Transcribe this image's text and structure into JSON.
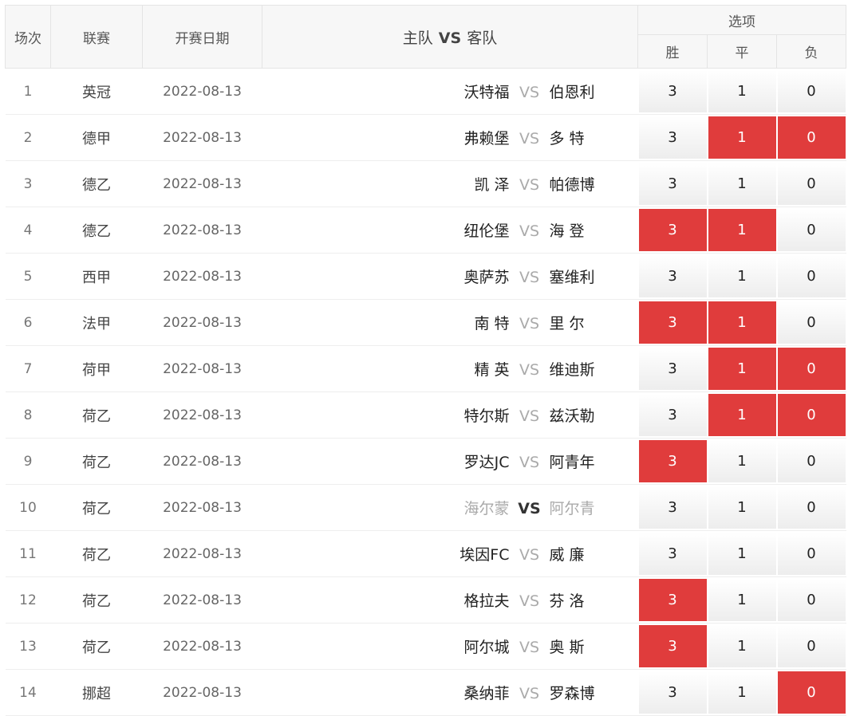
{
  "header": {
    "no": "场次",
    "league": "联赛",
    "date": "开赛日期",
    "home": "主队",
    "vs": "VS",
    "away": "客队",
    "options": "选项",
    "win": "胜",
    "draw": "平",
    "loss": "负"
  },
  "colors": {
    "selected": "#e03c3c",
    "button": "#f2f2f2"
  },
  "matches": [
    {
      "no": "1",
      "league": "英冠",
      "date": "2022-08-13",
      "home": "沃特福",
      "vs": "VS",
      "away": "伯恩利",
      "win": "3",
      "draw": "1",
      "loss": "0",
      "sel": []
    },
    {
      "no": "2",
      "league": "德甲",
      "date": "2022-08-13",
      "home": "弗赖堡",
      "vs": "VS",
      "away": "多 特",
      "win": "3",
      "draw": "1",
      "loss": "0",
      "sel": [
        "draw",
        "loss"
      ]
    },
    {
      "no": "3",
      "league": "德乙",
      "date": "2022-08-13",
      "home": "凯 泽",
      "vs": "VS",
      "away": "帕德博",
      "win": "3",
      "draw": "1",
      "loss": "0",
      "sel": []
    },
    {
      "no": "4",
      "league": "德乙",
      "date": "2022-08-13",
      "home": "纽伦堡",
      "vs": "VS",
      "away": "海 登",
      "win": "3",
      "draw": "1",
      "loss": "0",
      "sel": [
        "win",
        "draw"
      ]
    },
    {
      "no": "5",
      "league": "西甲",
      "date": "2022-08-13",
      "home": "奥萨苏",
      "vs": "VS",
      "away": "塞维利",
      "win": "3",
      "draw": "1",
      "loss": "0",
      "sel": []
    },
    {
      "no": "6",
      "league": "法甲",
      "date": "2022-08-13",
      "home": "南 特",
      "vs": "VS",
      "away": "里 尔",
      "win": "3",
      "draw": "1",
      "loss": "0",
      "sel": [
        "win",
        "draw"
      ]
    },
    {
      "no": "7",
      "league": "荷甲",
      "date": "2022-08-13",
      "home": "精 英",
      "vs": "VS",
      "away": "维迪斯",
      "win": "3",
      "draw": "1",
      "loss": "0",
      "sel": [
        "draw",
        "loss"
      ]
    },
    {
      "no": "8",
      "league": "荷乙",
      "date": "2022-08-13",
      "home": "特尔斯",
      "vs": "VS",
      "away": "兹沃勒",
      "win": "3",
      "draw": "1",
      "loss": "0",
      "sel": [
        "draw",
        "loss"
      ]
    },
    {
      "no": "9",
      "league": "荷乙",
      "date": "2022-08-13",
      "home": "罗达JC",
      "vs": "VS",
      "away": "阿青年",
      "win": "3",
      "draw": "1",
      "loss": "0",
      "sel": [
        "win"
      ]
    },
    {
      "no": "10",
      "league": "荷乙",
      "date": "2022-08-13",
      "home": "海尔蒙",
      "vs": "VS",
      "away": "阿尔青",
      "win": "3",
      "draw": "1",
      "loss": "0",
      "sel": [],
      "dim": true
    },
    {
      "no": "11",
      "league": "荷乙",
      "date": "2022-08-13",
      "home": "埃因FC",
      "vs": "VS",
      "away": "威 廉",
      "win": "3",
      "draw": "1",
      "loss": "0",
      "sel": []
    },
    {
      "no": "12",
      "league": "荷乙",
      "date": "2022-08-13",
      "home": "格拉夫",
      "vs": "VS",
      "away": "芬 洛",
      "win": "3",
      "draw": "1",
      "loss": "0",
      "sel": [
        "win"
      ]
    },
    {
      "no": "13",
      "league": "荷乙",
      "date": "2022-08-13",
      "home": "阿尔城",
      "vs": "VS",
      "away": "奥 斯",
      "win": "3",
      "draw": "1",
      "loss": "0",
      "sel": [
        "win"
      ]
    },
    {
      "no": "14",
      "league": "挪超",
      "date": "2022-08-13",
      "home": "桑纳菲",
      "vs": "VS",
      "away": "罗森博",
      "win": "3",
      "draw": "1",
      "loss": "0",
      "sel": [
        "loss"
      ]
    }
  ]
}
